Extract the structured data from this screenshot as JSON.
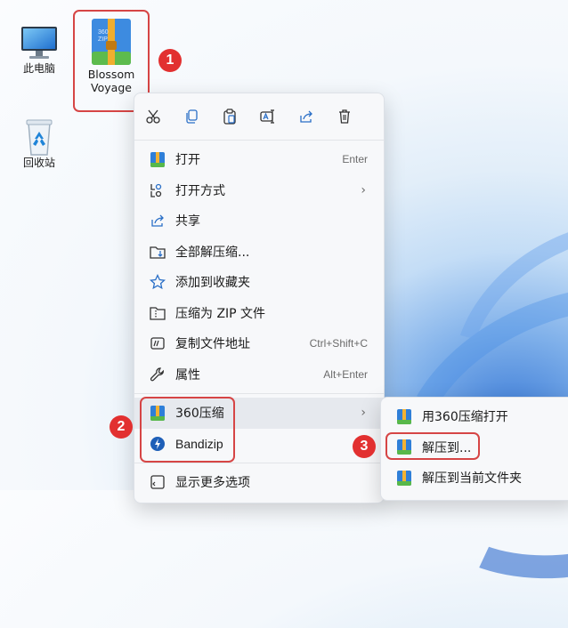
{
  "desktop": {
    "icons": [
      {
        "label": "此电脑",
        "icon": "monitor-icon"
      },
      {
        "label": "回收站",
        "icon": "recycle-bin-icon"
      },
      {
        "label": "Blossom Voyage",
        "icon": "zip-archive-icon"
      }
    ]
  },
  "badges": [
    "1",
    "2",
    "3"
  ],
  "toolbar": {
    "icons": [
      "cut-icon",
      "copy-icon",
      "paste-icon",
      "rename-icon",
      "share-icon",
      "delete-icon"
    ]
  },
  "menu": {
    "items": [
      {
        "label": "打开",
        "shortcut": "Enter",
        "icon": "zip-archive-icon"
      },
      {
        "label": "打开方式",
        "shortcut": "",
        "icon": "open-with-icon",
        "submenu": true
      },
      {
        "label": "共享",
        "shortcut": "",
        "icon": "share-icon"
      },
      {
        "label": "全部解压缩...",
        "shortcut": "",
        "icon": "extract-folder-icon"
      },
      {
        "label": "添加到收藏夹",
        "shortcut": "",
        "icon": "star-icon"
      },
      {
        "label": "压缩为 ZIP 文件",
        "shortcut": "",
        "icon": "zip-folder-icon"
      },
      {
        "label": "复制文件地址",
        "shortcut": "Ctrl+Shift+C",
        "icon": "copy-path-icon"
      },
      {
        "label": "属性",
        "shortcut": "Alt+Enter",
        "icon": "wrench-icon"
      },
      {
        "label": "360压缩",
        "shortcut": "",
        "icon": "zip-archive-icon",
        "submenu": true
      },
      {
        "label": "Bandizip",
        "shortcut": "",
        "icon": "bandizip-icon"
      },
      {
        "label": "显示更多选项",
        "shortcut": "",
        "icon": "more-options-icon"
      }
    ]
  },
  "submenu": {
    "items": [
      {
        "label": "用360压缩打开",
        "icon": "zip-archive-icon"
      },
      {
        "label": "解压到...",
        "icon": "zip-archive-icon"
      },
      {
        "label": "解压到当前文件夹",
        "icon": "zip-archive-icon"
      }
    ]
  },
  "colors": {
    "accent": "#e23030",
    "highlight_box": "#d64545"
  }
}
